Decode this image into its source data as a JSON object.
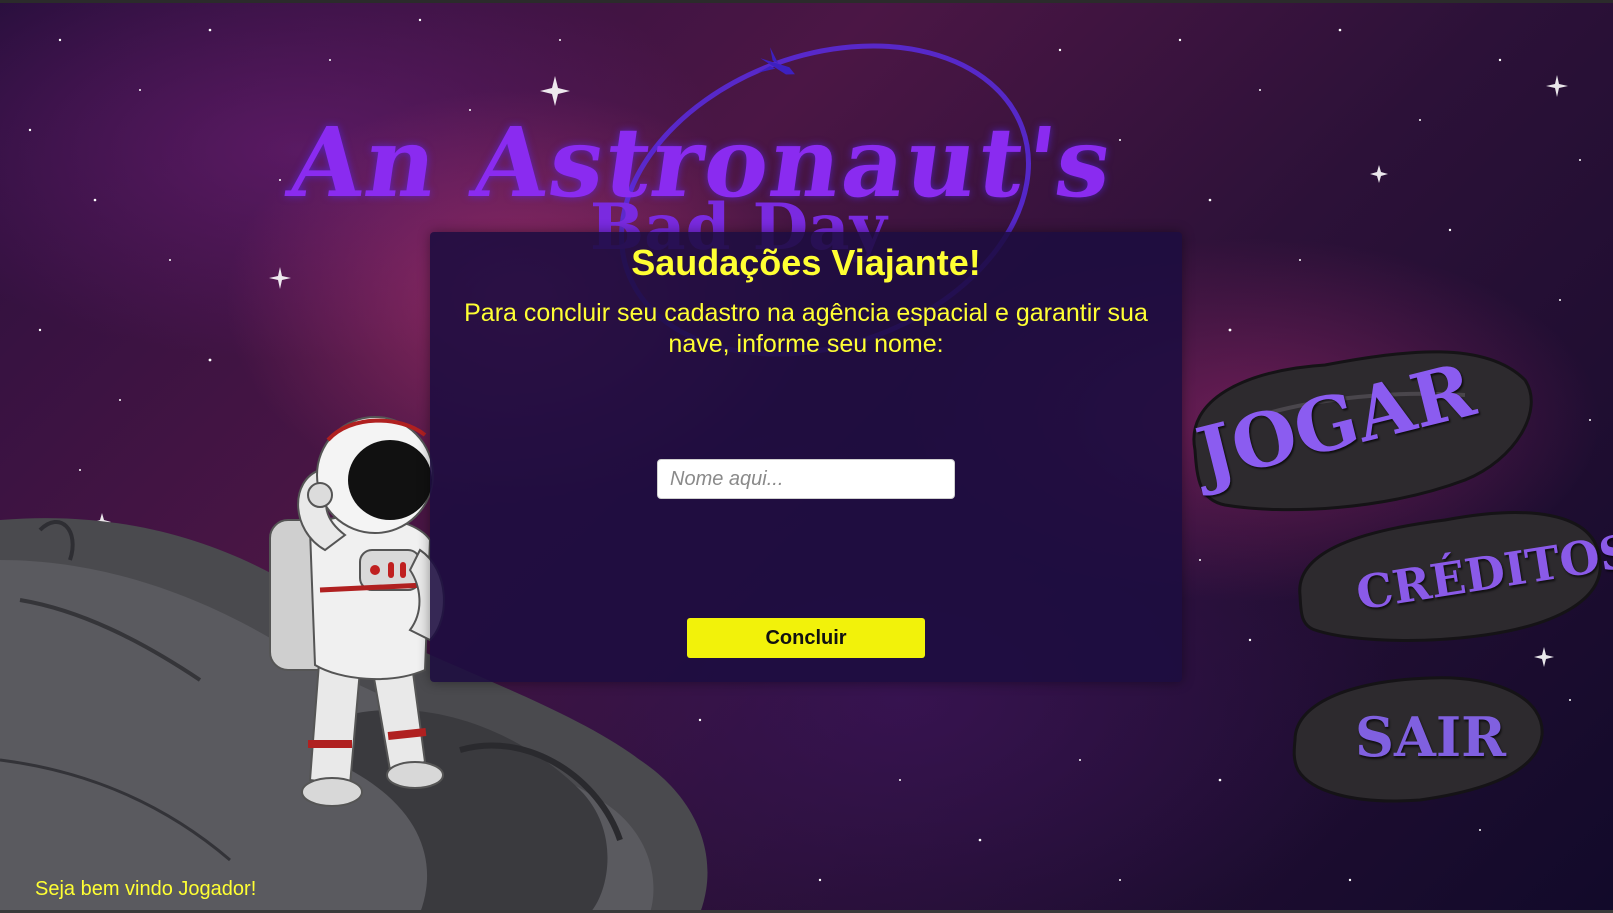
{
  "game": {
    "title_line1": "An Astronaut's",
    "title_line2": "Bad Day"
  },
  "menu": {
    "play": "JOGAR",
    "credits": "CRÉDITOS",
    "exit": "SAIR"
  },
  "dialog": {
    "title": "Saudações Viajante!",
    "body": "Para concluir seu cadastro na agência espacial e garantir sua nave, informe seu nome:",
    "input_placeholder": "Nome aqui...",
    "input_value": "",
    "submit_label": "Concluir"
  },
  "footer": {
    "welcome": "Seja bem vindo Jogador!"
  },
  "colors": {
    "accent_yellow": "#ffff33",
    "button_yellow": "#f2f20a",
    "title_purple": "#8a2bf0",
    "dialog_bg": "#1c0c40"
  }
}
